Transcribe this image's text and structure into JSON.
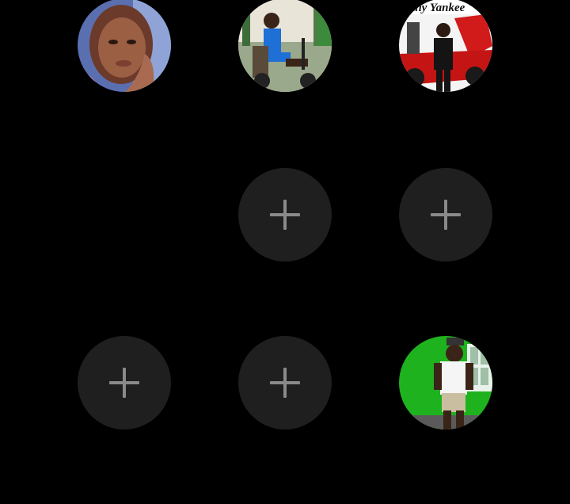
{
  "avatars": [
    {
      "id": "contact-1",
      "kind": "photo",
      "caption": ""
    },
    {
      "id": "contact-2",
      "kind": "photo",
      "caption": ""
    },
    {
      "id": "contact-3",
      "kind": "photo",
      "caption": "nny Yankee"
    },
    {
      "id": "contact-4",
      "kind": "photo",
      "caption": ""
    }
  ],
  "add_slot_icon": "plus-icon",
  "colors": {
    "background": "#000000",
    "add_slot_fill": "#1f1f1f",
    "plus_color": "#8a8a8a",
    "green_wall": "#1fb21f"
  }
}
